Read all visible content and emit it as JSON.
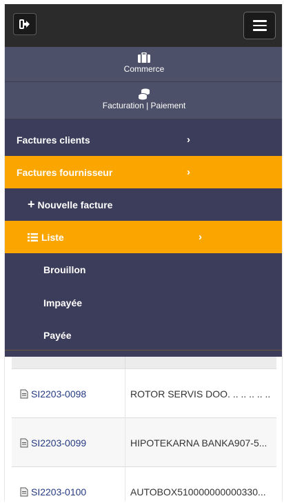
{
  "topbar": {
    "logout_icon": "logout-icon",
    "menu_icon": "hamburger-icon"
  },
  "sections": {
    "commerce": {
      "label": "Commerce",
      "icon": "briefcase-icon"
    },
    "facturation": {
      "label": "Facturation | Paiement",
      "icon": "coins-icon"
    }
  },
  "menu": {
    "factures_clients": "Factures clients",
    "factures_fournisseur": "Factures fournisseur",
    "nouvelle_facture": "Nouvelle facture",
    "liste": "Liste",
    "brouillon": "Brouillon",
    "impayee": "Impayée",
    "payee": "Payée",
    "chevron": "›",
    "plus": "+"
  },
  "colors": {
    "active": "#fba600",
    "menu_bg": "#3b3d5a",
    "section_bg": "#4c5068",
    "topbar_bg": "#2b2b2b",
    "link": "#243a83"
  },
  "table": {
    "rows": [
      {
        "ref": "SI2203-0098",
        "name": "ROTOR SERVIS DOO. .. .. .. .. .."
      },
      {
        "ref": "SI2203-0099",
        "name": "HIPOTEKARNA BANKA907-5..."
      },
      {
        "ref": "SI2203-0100",
        "name": "AUTOBOX510000000000330..."
      }
    ]
  }
}
